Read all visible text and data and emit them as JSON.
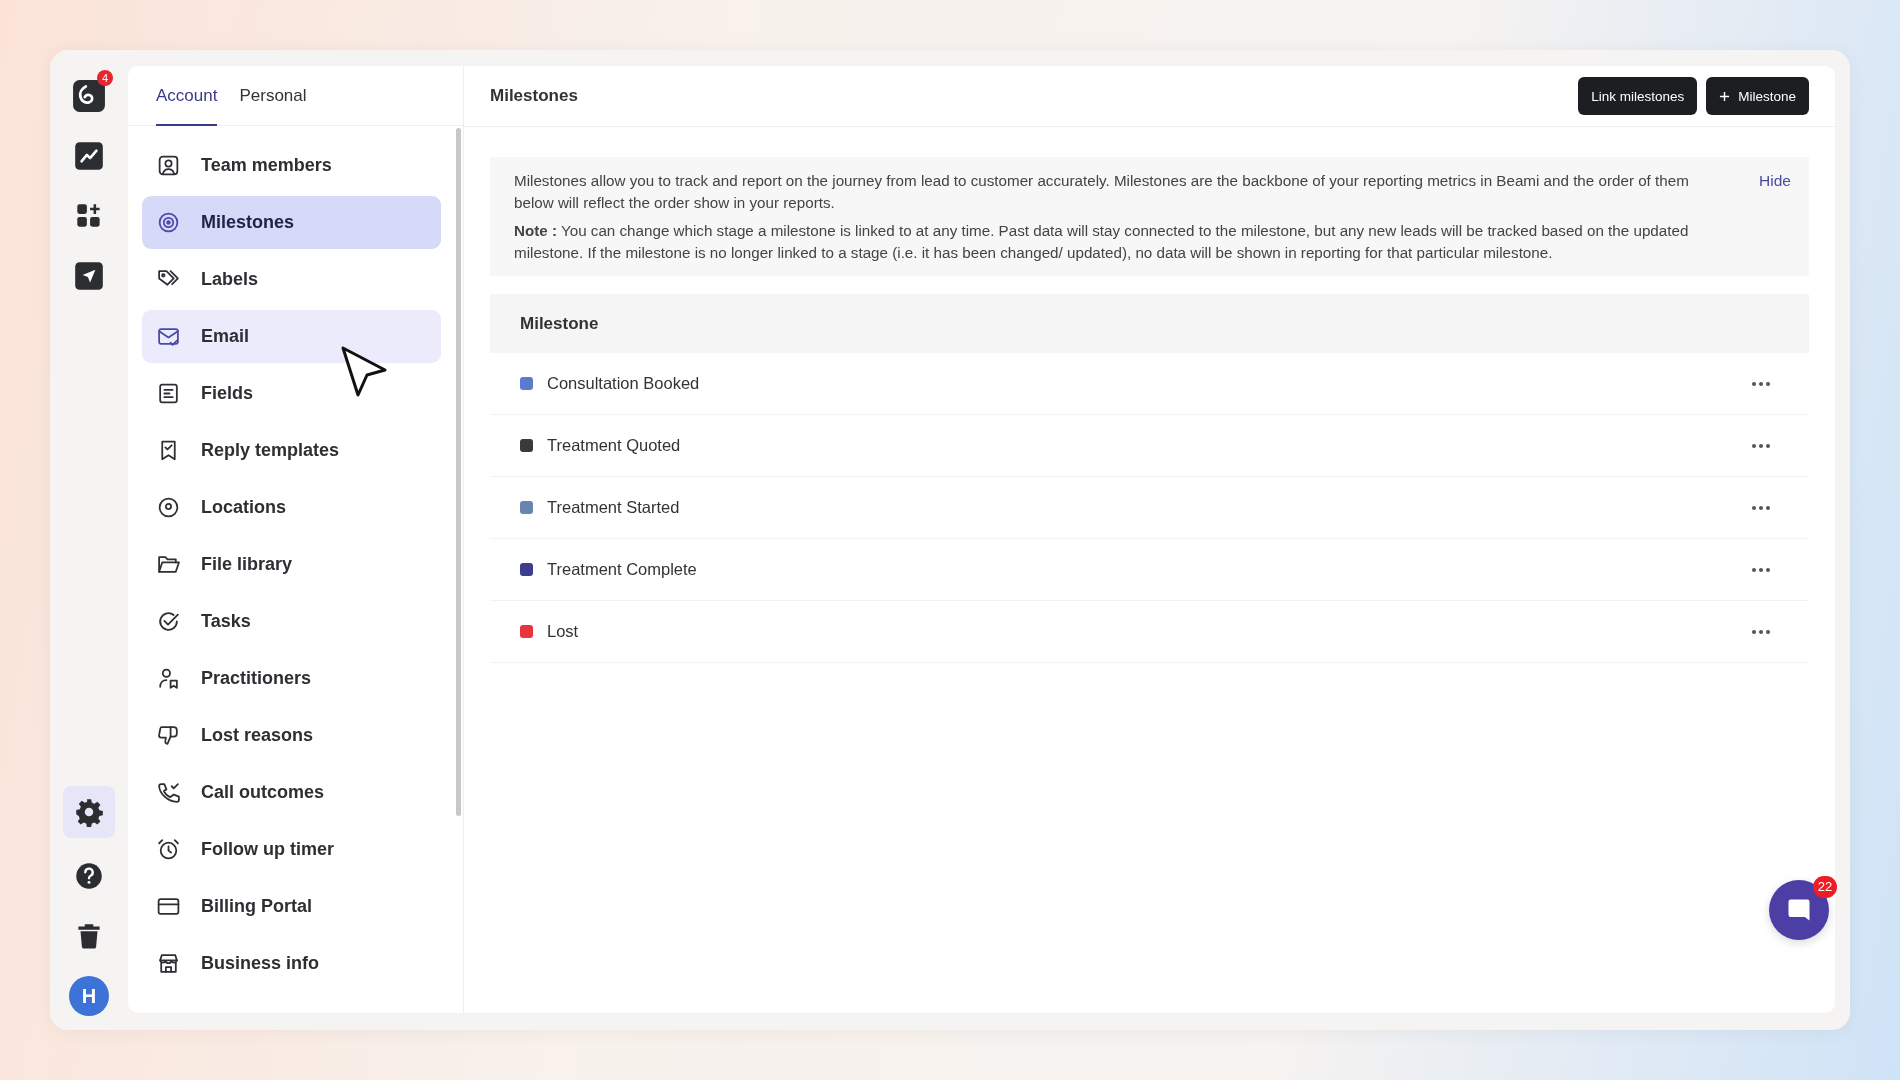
{
  "rail": {
    "top": [
      {
        "selected": false,
        "badge": "4"
      },
      {
        "selected": false
      },
      {
        "selected": false
      },
      {
        "selected": false
      }
    ],
    "bottom": [
      {
        "selected": true
      },
      {
        "selected": false
      },
      {
        "selected": false
      }
    ],
    "avatar": {
      "initial": "H"
    }
  },
  "sidebar": {
    "tabs": [
      {
        "label": "Account",
        "selected": true
      },
      {
        "label": "Personal",
        "selected": false
      }
    ],
    "items": [
      {
        "label": "Team members",
        "selected": false,
        "hovered": false
      },
      {
        "label": "Milestones",
        "selected": true,
        "hovered": false
      },
      {
        "label": "Labels",
        "selected": false,
        "hovered": false
      },
      {
        "label": "Email",
        "selected": false,
        "hovered": true
      },
      {
        "label": "Fields",
        "selected": false,
        "hovered": false
      },
      {
        "label": "Reply templates",
        "selected": false,
        "hovered": false
      },
      {
        "label": "Locations",
        "selected": false,
        "hovered": false
      },
      {
        "label": "File library",
        "selected": false,
        "hovered": false
      },
      {
        "label": "Tasks",
        "selected": false,
        "hovered": false
      },
      {
        "label": "Practitioners",
        "selected": false,
        "hovered": false
      },
      {
        "label": "Lost reasons",
        "selected": false,
        "hovered": false
      },
      {
        "label": "Call outcomes",
        "selected": false,
        "hovered": false
      },
      {
        "label": "Follow up timer",
        "selected": false,
        "hovered": false
      },
      {
        "label": "Billing Portal",
        "selected": false,
        "hovered": false
      },
      {
        "label": "Business info",
        "selected": false,
        "hovered": false
      }
    ]
  },
  "header": {
    "title": "Milestones",
    "buttons": [
      {
        "label": "Link milestones",
        "kind": "plain"
      },
      {
        "label": "Milestone",
        "kind": "add"
      }
    ]
  },
  "info": {
    "text": "Milestones allow you to track and report on the journey from lead to customer accurately. Milestones are the backbone of your reporting metrics in Beami and the order of them below will reflect the order show in your reports.",
    "note": "**Note :** You can change which stage a milestone is linked to at any time. Past data will stay connected to the milestone, but any new leads will be tracked based on the updated milestone. If the milestone is no longer linked to a stage (i.e. it has been changed/ updated), no data will be shown in reporting for that particular milestone.",
    "action": "Hide"
  },
  "table": {
    "columns": [
      "Milestone"
    ],
    "rows": [
      {
        "name": "Consultation Booked",
        "color": "#5a7ccc"
      },
      {
        "name": "Treatment Quoted",
        "color": "#3a3a3a"
      },
      {
        "name": "Treatment Started",
        "color": "#6a84b0"
      },
      {
        "name": "Treatment Complete",
        "color": "#3d3d8f"
      },
      {
        "name": "Lost",
        "color": "#e8343f"
      }
    ]
  },
  "chat": {
    "badge": "22"
  }
}
